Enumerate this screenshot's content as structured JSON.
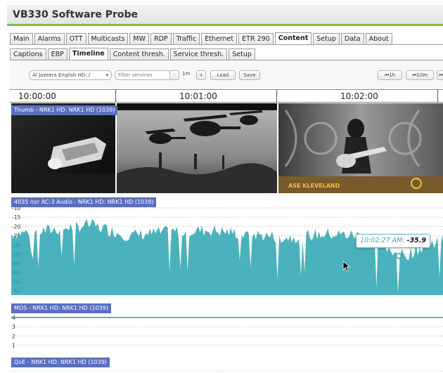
{
  "app": {
    "title": "VB330 Software Probe"
  },
  "main_tabs": [
    "Main",
    "Alarms",
    "OTT",
    "Multicasts",
    "MW",
    "RDP",
    "Traffic",
    "Ethernet",
    "ETR 290",
    "Content",
    "Setup",
    "Data",
    "About"
  ],
  "main_active": "Content",
  "sub_tabs": [
    "Captions",
    "EBP",
    "Timeline",
    "Content thresh.",
    "Service thresh.",
    "Setup"
  ],
  "sub_active": "Timeline",
  "controls": {
    "service_select": "Al Jazeera English HD: /",
    "filter_placeholder": "Filter services",
    "zoom_minus": "-",
    "zoom_value": "1m",
    "zoom_plus": "+",
    "load": "Load",
    "save": "Save",
    "back_1h": "⏮1h",
    "back_10m": "⏮10m",
    "back_more": "⏮"
  },
  "timeline": {
    "ticks": [
      "10:00:00",
      "10:01:00",
      "10:02:00"
    ]
  },
  "lanes": {
    "thumb": "Thumb - NRK1 HD: NRK1 HD (1039)",
    "audio": "4035 nor AC-3 Audio - NRK1 HD: NRK1 HD (1039)",
    "mos": "MOS - NRK1 HD: NRK1 HD (1039)",
    "qoe": "QoE - NRK1 HD: NRK1 HD (1039)"
  },
  "thumb_overlay_text": "ASE KLEVELAND",
  "audio_axis": [
    "-10",
    "-15",
    "-20",
    "-25",
    "-30",
    "-35",
    "-40",
    "-45",
    "-50",
    "-55"
  ],
  "mos_axis": [
    "4",
    "3",
    "2",
    "1"
  ],
  "tooltip": {
    "time": "10:02:27 AM:",
    "value": "-35.9"
  },
  "colors": {
    "accent_green": "#7cc242",
    "lane_label": "#5b6fc0",
    "audio_fill": "#2aa5b0",
    "tooltip_border": "#6cb8c8"
  },
  "chart_data": [
    {
      "type": "area",
      "title": "4035 nor AC-3 Audio - NRK1 HD: NRK1 HD (1039)",
      "x": [
        "10:00:00",
        "10:00:15",
        "10:00:30",
        "10:00:45",
        "10:01:00",
        "10:01:15",
        "10:01:30",
        "10:01:45",
        "10:02:00",
        "10:02:15",
        "10:02:27",
        "10:02:40"
      ],
      "values": [
        -24,
        -22,
        -19,
        -25,
        -23,
        -22,
        -24,
        -26,
        -24,
        -25,
        -35.9,
        -26
      ],
      "ylim": [
        -57,
        -10
      ],
      "grid": true,
      "xlabel": "",
      "ylabel": ""
    },
    {
      "type": "line",
      "title": "MOS - NRK1 HD: NRK1 HD (1039)",
      "x": [
        "10:00:00",
        "10:02:40"
      ],
      "values": [
        4,
        4
      ],
      "ylim": [
        0.5,
        4
      ],
      "grid": true,
      "xlabel": "",
      "ylabel": ""
    }
  ]
}
